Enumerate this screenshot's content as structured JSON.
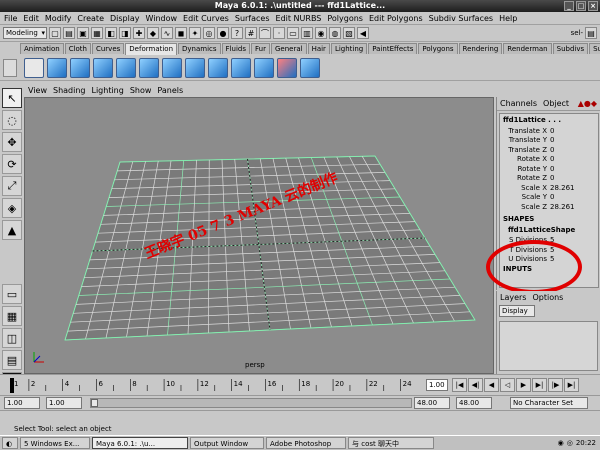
{
  "window": {
    "title": "Maya 6.0.1: .\\untitled    ---    ffd1Lattice..."
  },
  "menu": [
    "File",
    "Edit",
    "Modify",
    "Create",
    "Display",
    "Window",
    "Edit Curves",
    "Surfaces",
    "Edit NURBS",
    "Polygons",
    "Edit Polygons",
    "Subdiv Surfaces",
    "Help"
  ],
  "status": {
    "mode": "Modeling",
    "sel_label": "sel-"
  },
  "shelf_tabs": [
    "Animation",
    "Cloth",
    "Curves",
    "Deformation",
    "Dynamics",
    "Fluids",
    "Fur",
    "General",
    "Hair",
    "Lighting",
    "PaintEffects",
    "Polygons",
    "Rendering",
    "Renderman",
    "Subdivs",
    "Surfaces"
  ],
  "shelf_active": "Deformation",
  "panel_menu": [
    "View",
    "Shading",
    "Lighting",
    "Show",
    "Panels"
  ],
  "viewport": {
    "camera_label": "persp"
  },
  "watermark": {
    "line1": "王晓宇 05 7 3 MAYA 云的制作"
  },
  "channelbox": {
    "tabs": [
      "Channels",
      "Object"
    ],
    "node": "ffd1Lattice . . .",
    "attributes": [
      {
        "name": "Translate X",
        "value": "0"
      },
      {
        "name": "Translate Y",
        "value": "0"
      },
      {
        "name": "Translate Z",
        "value": "0"
      },
      {
        "name": "Rotate X",
        "value": "0"
      },
      {
        "name": "Rotate Y",
        "value": "0"
      },
      {
        "name": "Rotate Z",
        "value": "0"
      },
      {
        "name": "Scale X",
        "value": "28.261"
      },
      {
        "name": "Scale Y",
        "value": "0"
      },
      {
        "name": "Scale Z",
        "value": "28.261"
      }
    ],
    "shapes_label": "SHAPES",
    "shape_node": "ffd1LatticeShape",
    "shape_attributes": [
      {
        "name": "S Divisions",
        "value": "5"
      },
      {
        "name": "T Divisions",
        "value": "5"
      },
      {
        "name": "U Divisions",
        "value": "5"
      }
    ],
    "inputs_label": "INPUTS"
  },
  "layers": {
    "tabs": [
      "Layers",
      "Options"
    ],
    "display": "Display"
  },
  "timeline": {
    "ticks": [
      "1",
      "2",
      "4",
      "6",
      "8",
      "10",
      "12",
      "14",
      "16",
      "18",
      "20",
      "22",
      "24"
    ],
    "current_frame": "1.00"
  },
  "range": {
    "start": "1.00",
    "start_inner": "1.00",
    "end_inner": "48.00",
    "end": "48.00",
    "character_set": "No Character Set"
  },
  "help": {
    "text": "Select Tool: select an object"
  },
  "taskbar": {
    "items": [
      "5 Windows Ex...",
      "Maya 6.0.1: .\\u...",
      "Output Window",
      "Adobe Photoshop",
      "与 cost 聊天中"
    ],
    "active": 1,
    "clock": "20:22"
  }
}
